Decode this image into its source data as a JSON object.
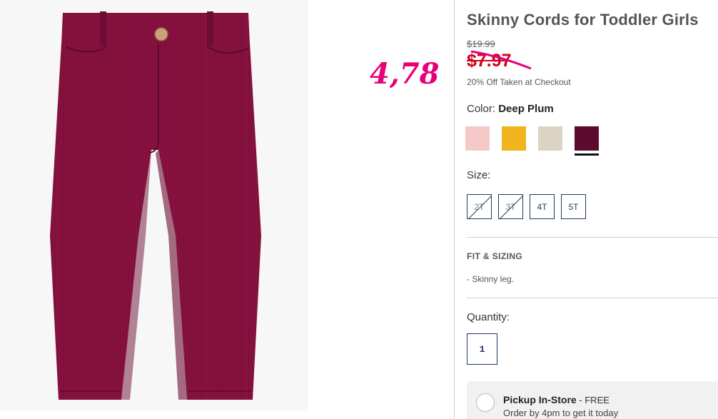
{
  "product": {
    "title": "Skinny Cords for Toddler Girls",
    "image_alt": "Deep plum corduroy skinny pants"
  },
  "annotation": {
    "handwritten_price": "4,78"
  },
  "price": {
    "original": "$19.99",
    "sale": "$7.97",
    "promo_note": "20% Off Taken at Checkout",
    "sale_color": "#d0021b"
  },
  "color": {
    "label": "Color:",
    "selected_name": "Deep Plum",
    "swatches": [
      {
        "name": "light-pink",
        "hex": "#f6c9c9",
        "selected": false
      },
      {
        "name": "mustard-yellow",
        "hex": "#f0b41c",
        "selected": false
      },
      {
        "name": "oatmeal",
        "hex": "#ddd3c4",
        "selected": false
      },
      {
        "name": "deep-plum",
        "hex": "#5c0a2e",
        "selected": true
      }
    ]
  },
  "size": {
    "label": "Size:",
    "options": [
      {
        "label": "2T",
        "available": false
      },
      {
        "label": "3T",
        "available": false
      },
      {
        "label": "4T",
        "available": true
      },
      {
        "label": "5T",
        "available": true
      }
    ]
  },
  "fit": {
    "heading": "FIT & SIZING",
    "items": [
      "-  Skinny leg."
    ]
  },
  "quantity": {
    "label": "Quantity:",
    "value": "1"
  },
  "pickup": {
    "title": "Pickup In-Store",
    "free": " - FREE",
    "subtitle": "Order by 4pm to get it today"
  },
  "colors": {
    "accent_navy": "#1e3a5f",
    "annotation_pink": "#e6007a",
    "product_plum": "#8a1240"
  }
}
